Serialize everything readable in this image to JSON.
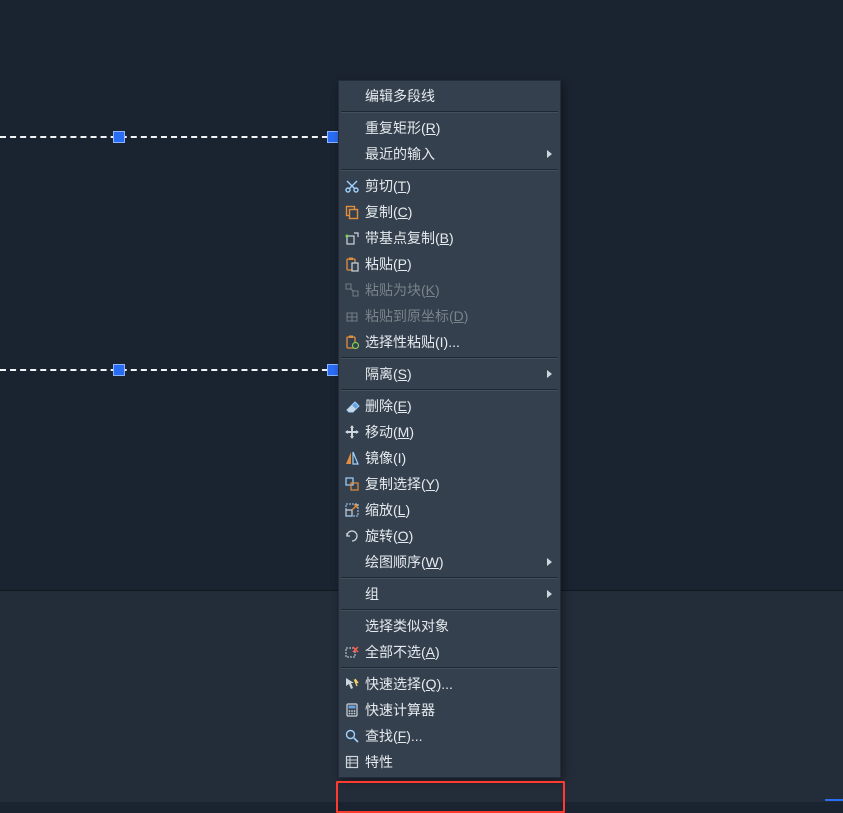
{
  "menu": {
    "edit_polyline": "编辑多段线",
    "repeat_rect": {
      "text": "重复矩形(",
      "key": "R",
      "tail": ")"
    },
    "recent_inputs": "最近的输入",
    "cut": {
      "text": "剪切(",
      "key": "T",
      "tail": ")"
    },
    "copy": {
      "text": "复制(",
      "key": "C",
      "tail": ")"
    },
    "copy_base": {
      "text": "带基点复制(",
      "key": "B",
      "tail": ")"
    },
    "paste": {
      "text": "粘贴(",
      "key": "P",
      "tail": ")"
    },
    "paste_block": {
      "text": "粘贴为块(",
      "key": "K",
      "tail": ")"
    },
    "paste_orig": {
      "text": "粘贴到原坐标(",
      "key": "D",
      "tail": ")"
    },
    "paste_special": "选择性粘贴(I)...",
    "isolate": {
      "text": "隔离(",
      "key": "S",
      "tail": ")"
    },
    "delete": {
      "text": "删除(",
      "key": "E",
      "tail": ")"
    },
    "move": {
      "text": "移动(",
      "key": "M",
      "tail": ")"
    },
    "mirror": "镜像(I)",
    "copy_sel": {
      "text": "复制选择(",
      "key": "Y",
      "tail": ")"
    },
    "scale": {
      "text": "缩放(",
      "key": "L",
      "tail": ")"
    },
    "rotate": {
      "text": "旋转(",
      "key": "O",
      "tail": ")"
    },
    "draw_order": {
      "text": "绘图顺序(",
      "key": "W",
      "tail": ")"
    },
    "group": "组",
    "select_similar": "选择类似对象",
    "deselect_all": {
      "text": "全部不选(",
      "key": "A",
      "tail": ")"
    },
    "quick_select": {
      "text": "快速选择(",
      "key": "Q",
      "tail": ")..."
    },
    "quick_calc": "快速计算器",
    "find": {
      "text": "查找(",
      "key": "F",
      "tail": ")..."
    },
    "properties": "特性"
  }
}
